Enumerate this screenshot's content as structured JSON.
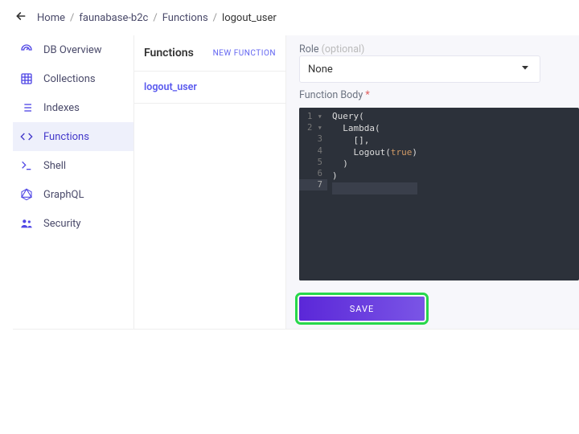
{
  "breadcrumb": {
    "items": [
      "Home",
      "faunabase-b2c",
      "Functions",
      "logout_user"
    ]
  },
  "sidebar": {
    "items": [
      {
        "icon": "meter",
        "label": "DB Overview"
      },
      {
        "icon": "grid",
        "label": "Collections"
      },
      {
        "icon": "list",
        "label": "Indexes"
      },
      {
        "icon": "code",
        "label": "Functions",
        "active": true
      },
      {
        "icon": "shell",
        "label": "Shell"
      },
      {
        "icon": "graphql",
        "label": "GraphQL"
      },
      {
        "icon": "security",
        "label": "Security"
      }
    ]
  },
  "functions_panel": {
    "title": "Functions",
    "new_label": "NEW FUNCTION",
    "items": [
      "logout_user"
    ]
  },
  "form": {
    "role": {
      "label": "Role",
      "optional_text": "(optional)",
      "value": "None"
    },
    "body": {
      "label": "Function Body"
    },
    "save_label": "SAVE"
  },
  "code": {
    "lines": [
      {
        "n": 1,
        "text": "Query(",
        "fold": true
      },
      {
        "n": 2,
        "text": "  Lambda(",
        "fold": true
      },
      {
        "n": 3,
        "text": "    [],"
      },
      {
        "n": 4,
        "text": "    Logout(true)"
      },
      {
        "n": 5,
        "text": "  )"
      },
      {
        "n": 6,
        "text": ")"
      },
      {
        "n": 7,
        "text": "",
        "active": true
      }
    ]
  }
}
